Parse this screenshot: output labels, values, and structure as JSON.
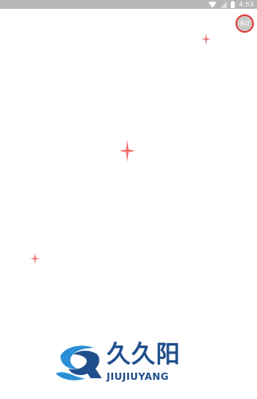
{
  "status_bar": {
    "time": "4:53",
    "icons": [
      "wifi-icon",
      "signal-icon",
      "battery-icon"
    ]
  },
  "skip_button": {
    "label": "跳过"
  },
  "logo": {
    "chinese_name": "久久阳",
    "english_name": "JIUJIUYANG"
  },
  "colors": {
    "status_bar_bg": "#b6b6b6",
    "skip_border": "#e53935",
    "sparkle": "#f07070",
    "logo_blue": "#1f4e8c",
    "logo_light_blue": "#2a8fd6"
  }
}
